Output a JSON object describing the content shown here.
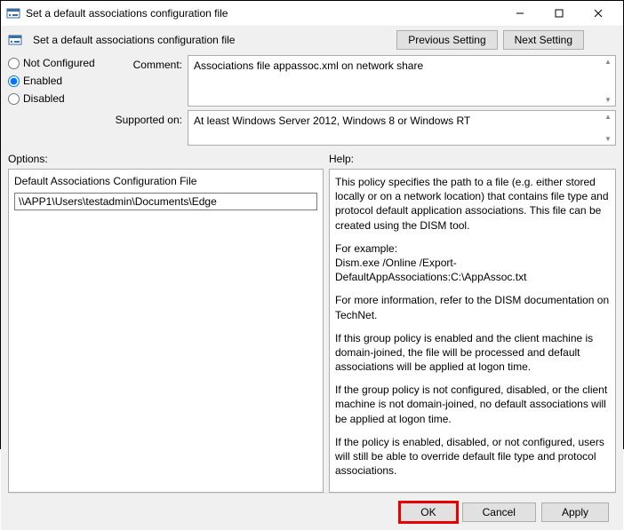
{
  "titlebar": {
    "title": "Set a default associations configuration file"
  },
  "header": {
    "label": "Set a default associations configuration file"
  },
  "nav": {
    "prev": "Previous Setting",
    "next": "Next Setting"
  },
  "state": {
    "not_configured": "Not Configured",
    "enabled": "Enabled",
    "disabled": "Disabled",
    "selected": "enabled"
  },
  "meta": {
    "comment_label": "Comment:",
    "comment_value": "Associations file appassoc.xml on network share",
    "supported_label": "Supported on:",
    "supported_value": "At least Windows Server 2012, Windows 8 or Windows RT"
  },
  "options": {
    "section_label": "Options:",
    "field_label": "Default Associations Configuration File",
    "field_value": "\\\\APP1\\Users\\testadmin\\Documents\\Edge"
  },
  "help": {
    "section_label": "Help:",
    "p1": "This policy specifies the path to a file (e.g. either stored locally or on a network location) that contains file type and protocol default application associations. This file can be created using the DISM tool.",
    "p2a": "For example:",
    "p2b": "Dism.exe /Online /Export-DefaultAppAssociations:C:\\AppAssoc.txt",
    "p3": "For more information, refer to the DISM documentation on TechNet.",
    "p4": "If this group policy is enabled and the client machine is domain-joined, the file will be processed and default associations will be applied at logon time.",
    "p5": "If the group policy is not configured, disabled, or the client machine is not domain-joined, no default associations will be applied at logon time.",
    "p6": "If the policy is enabled, disabled, or not configured, users will still be able to override default file type and protocol associations."
  },
  "footer": {
    "ok": "OK",
    "cancel": "Cancel",
    "apply": "Apply"
  }
}
